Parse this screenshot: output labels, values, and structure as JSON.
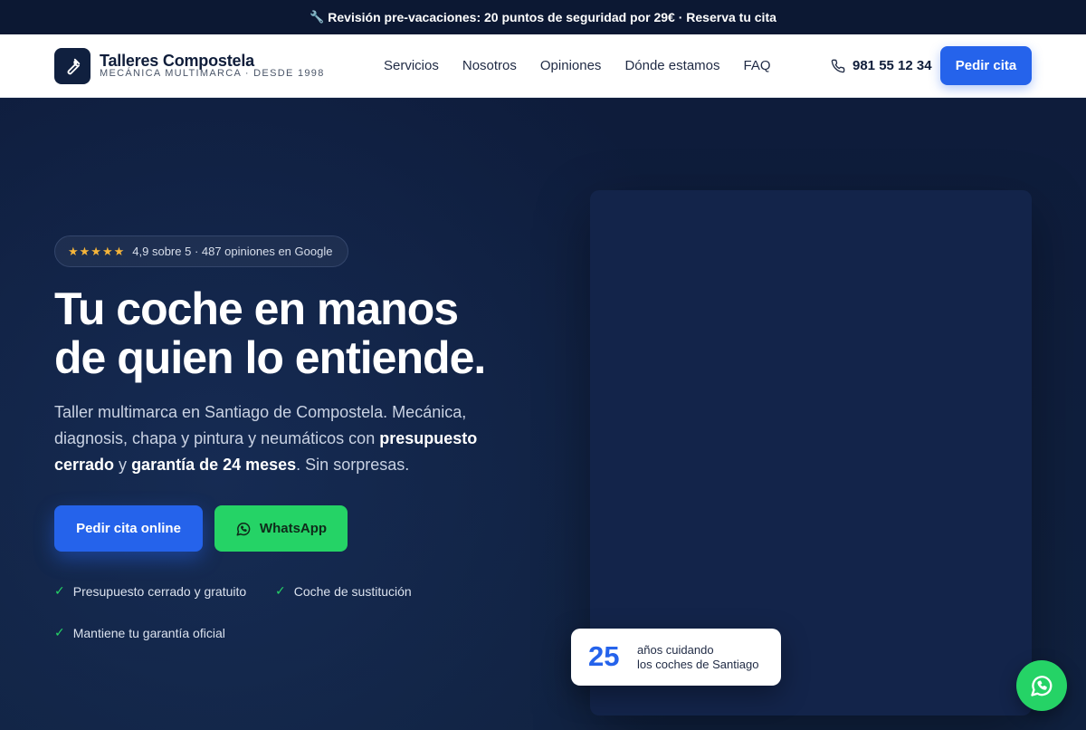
{
  "announcement": {
    "text": "Revisión pre-vacaciones: 20 puntos de seguridad por 29€ · Reserva tu cita"
  },
  "brand": {
    "name": "Talleres Compostela",
    "tagline": "MECÁNICA MULTIMARCA · DESDE 1998",
    "logo_icon": "wrench-icon"
  },
  "nav": {
    "items": [
      "Servicios",
      "Nosotros",
      "Opiniones",
      "Dónde estamos",
      "FAQ"
    ]
  },
  "contact": {
    "phone": "981 55 12 34",
    "cta_label": "Pedir cita"
  },
  "hero": {
    "rating_stars": "★★★★★",
    "rating_text": "4,9 sobre 5 · 487 opiniones en Google",
    "headline_line1": "Tu coche en manos",
    "headline_line2": "de quien lo entiende.",
    "lead_part1": "Taller multimarca en Santiago de Compostela. Mecánica, diagnosis, chapa y pintura y neumáticos con ",
    "lead_bold1": "presupuesto cerrado",
    "lead_part2": " y ",
    "lead_bold2": "garantía de 24 meses",
    "lead_part3": ". Sin sorpresas.",
    "primary_cta": "Pedir cita online",
    "whatsapp_cta": "WhatsApp",
    "checks": [
      "Presupuesto cerrado y gratuito",
      "Coche de sustitución",
      "Mantiene tu garantía oficial"
    ]
  },
  "badge": {
    "number": "25",
    "line1": "años cuidando",
    "line2": "los coches de Santiago"
  },
  "colors": {
    "accent": "#2563eb",
    "whatsapp": "#25d366",
    "navy": "#0f1d3a",
    "star": "#f6b53a"
  }
}
